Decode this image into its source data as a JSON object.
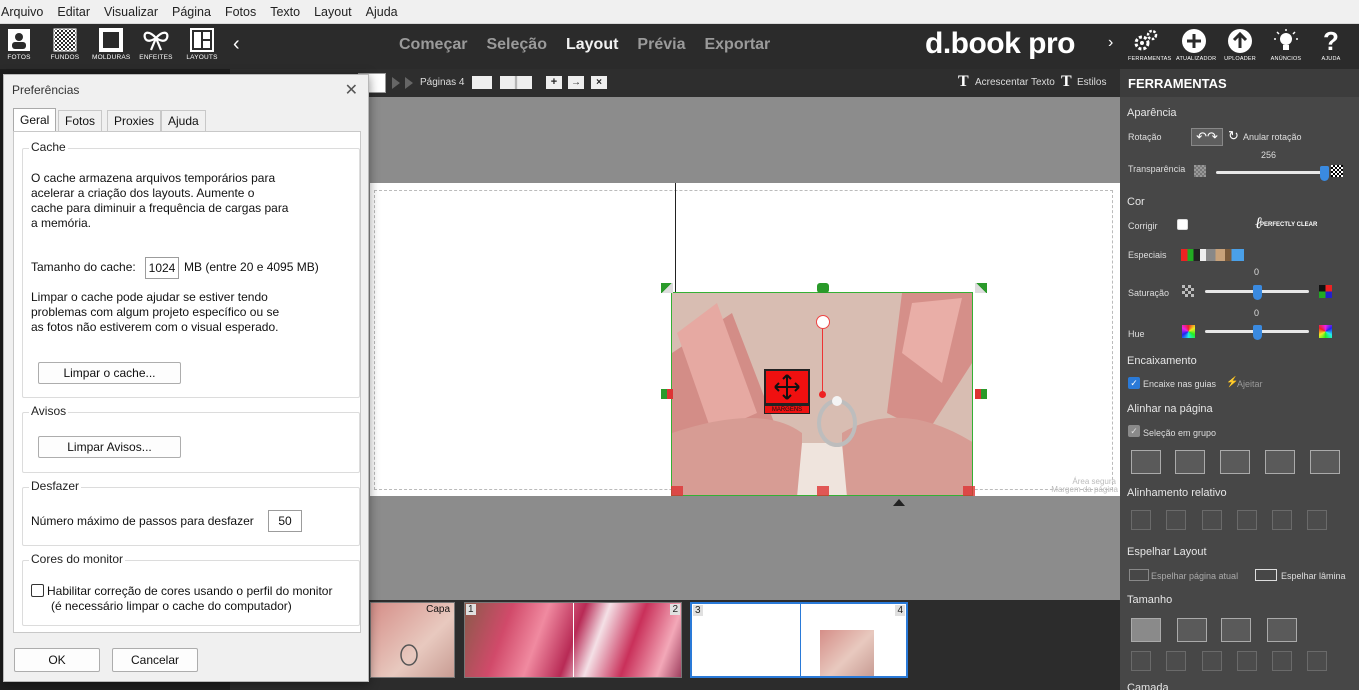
{
  "menubar": {
    "items": [
      "Arquivo",
      "Editar",
      "Visualizar",
      "Página",
      "Fotos",
      "Texto",
      "Layout",
      "Ajuda"
    ]
  },
  "toolbar": {
    "tools": [
      {
        "label": "FOTOS",
        "icon": "photos-icon"
      },
      {
        "label": "FUNDOS",
        "icon": "backgrounds-icon"
      },
      {
        "label": "MOLDURAS",
        "icon": "frames-icon"
      },
      {
        "label": "ENFEITES",
        "icon": "ribbon-icon"
      },
      {
        "label": "LAYOUTS",
        "icon": "layouts-icon"
      }
    ],
    "collapse_glyph": "‹",
    "steps": [
      "Começar",
      "Seleção",
      "Layout",
      "Prévia",
      "Exportar"
    ],
    "active_step": "Layout",
    "logo": "d.book pro",
    "logo_arrow": "›",
    "right_tools": [
      {
        "label": "FERRAMENTAS",
        "icon": "gears-icon"
      },
      {
        "label": "ATUALIZADOR",
        "icon": "plus-circle-icon"
      },
      {
        "label": "UPLOADER",
        "icon": "upload-icon"
      },
      {
        "label": "ANÚNCIOS",
        "icon": "lightbulb-icon"
      },
      {
        "label": "AJUDA",
        "icon": "help-icon"
      }
    ]
  },
  "subbar": {
    "pages_label": "Páginas 4",
    "add_text": "Acrescentar Texto",
    "styles": "Estilos"
  },
  "canvas": {
    "safe_area": "Área segura",
    "page_margin": "Margem da página",
    "margin_badge": "MARGENS"
  },
  "filmstrip": {
    "thumbs": [
      {
        "num": "Capa"
      },
      {
        "num": "1"
      },
      {
        "num": "2"
      },
      {
        "num": "3"
      },
      {
        "num": "4"
      }
    ]
  },
  "dialog": {
    "title": "Preferências",
    "close": "✕",
    "tabs": [
      "Geral",
      "Fotos",
      "Proxies",
      "Ajuda"
    ],
    "cache": {
      "title": "Cache",
      "desc": [
        "O cache armazena arquivos temporários para",
        "acelerar a criação dos layouts.  Aumente o",
        "cache para diminuir a frequência de cargas para",
        "a memória."
      ],
      "size_label": "Tamanho do cache:",
      "size_value": "1024",
      "size_unit": "MB (entre 20 e 4095 MB)",
      "clear_desc": [
        "Limpar o cache pode ajudar se estiver tendo",
        "problemas com algum projeto específico ou se",
        "as fotos não estiverem com o visual esperado."
      ],
      "clear_button": "Limpar o cache..."
    },
    "warnings": {
      "title": "Avisos",
      "clear_button": "Limpar Avisos..."
    },
    "undo": {
      "title": "Desfazer",
      "label": "Número máximo de passos para desfazer",
      "value": "50"
    },
    "monitor": {
      "title": "Cores do monitor",
      "checkbox_line1": "Habilitar correção de cores usando o perfil do monitor",
      "checkbox_line2": "(é necessário limpar o cache do computador)"
    },
    "ok": "OK",
    "cancel": "Cancelar"
  },
  "sidebar": {
    "title": "FERRAMENTAS",
    "appearance": "Aparência",
    "rotation": "Rotação",
    "undo_rotation": "Anular rotação",
    "transparency": "Transparência",
    "transparency_value": "256",
    "transparency_level": 1.0,
    "color": "Cor",
    "fix": "Corrigir",
    "perfectly_clear": "PERFECTLY CLEAR",
    "specials": "Especiais",
    "saturation": "Saturação",
    "saturation_value": "0",
    "saturation_level": 0.5,
    "hue": "Hue",
    "hue_value": "0",
    "hue_level": 0.5,
    "fitting": "Encaixamento",
    "snap_guides": "Encaixe nas guias",
    "adjust": "Ajeitar",
    "align_page": "Alinhar na página",
    "group_selection": "Seleção em grupo",
    "relative_align": "Alinhamento relativo",
    "mirror_layout": "Espelhar Layout",
    "mirror_page": "Espelhar página atual",
    "mirror_spread": "Espelhar lâmina",
    "size": "Tamanho",
    "layer": "Camada"
  }
}
